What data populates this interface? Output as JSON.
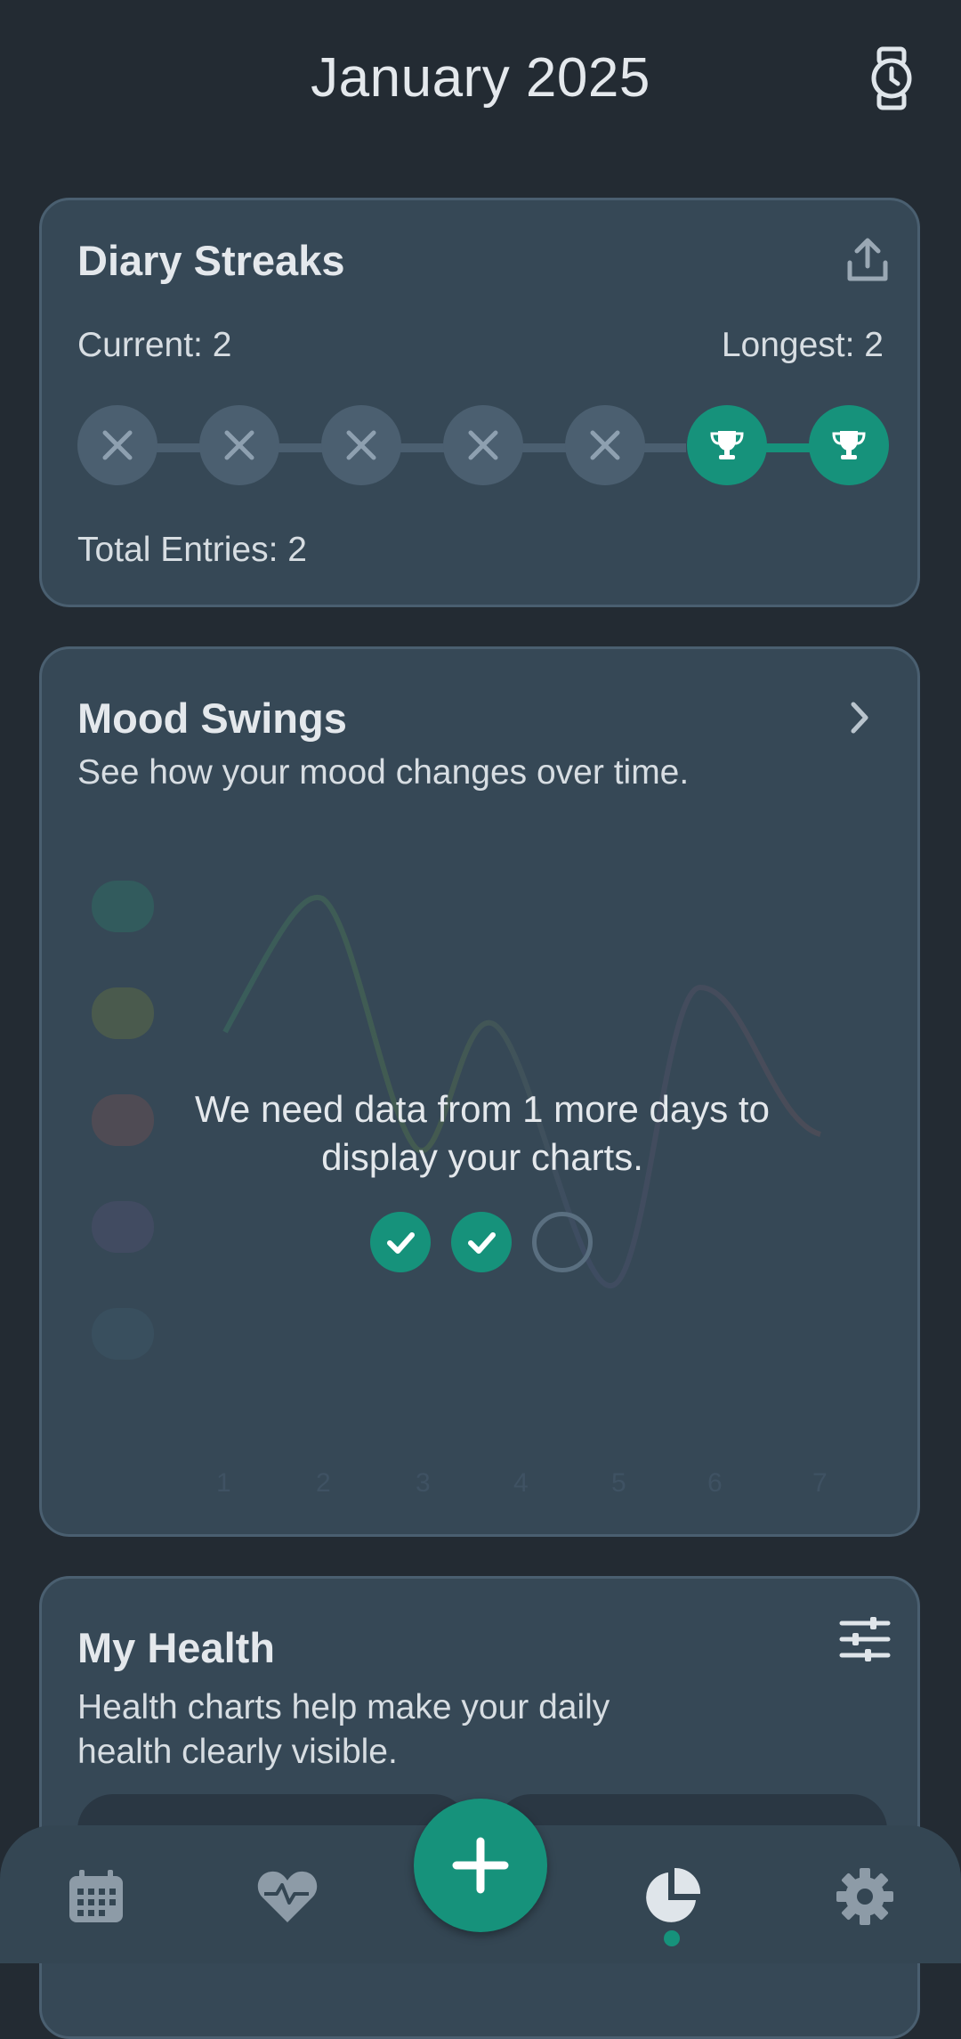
{
  "header": {
    "title": "January 2025"
  },
  "streaks": {
    "title": "Diary Streaks",
    "current": "Current: 2",
    "longest": "Longest: 2",
    "total": "Total Entries: 2",
    "days": [
      "missed",
      "missed",
      "missed",
      "missed",
      "missed",
      "done",
      "done"
    ]
  },
  "mood": {
    "title": "Mood Swings",
    "subtitle": "See how your mood changes over time.",
    "message_line1": "We need data from 1 more days to",
    "message_line2": "display your charts.",
    "progress": [
      "done",
      "done",
      "pending"
    ],
    "x_ticks": [
      "1",
      "2",
      "3",
      "4",
      "5",
      "6",
      "7"
    ]
  },
  "health": {
    "title": "My Health",
    "subtitle_line1": "Health charts help make your daily",
    "subtitle_line2": "health clearly visible."
  },
  "nav": {
    "items": [
      "calendar-icon",
      "heart-icon",
      "add-icon",
      "pie-chart-icon",
      "gear-icon"
    ],
    "active": "pie-chart-icon"
  },
  "colors": {
    "accent": "#16927b",
    "background": "#232b33",
    "card": "#364856"
  }
}
